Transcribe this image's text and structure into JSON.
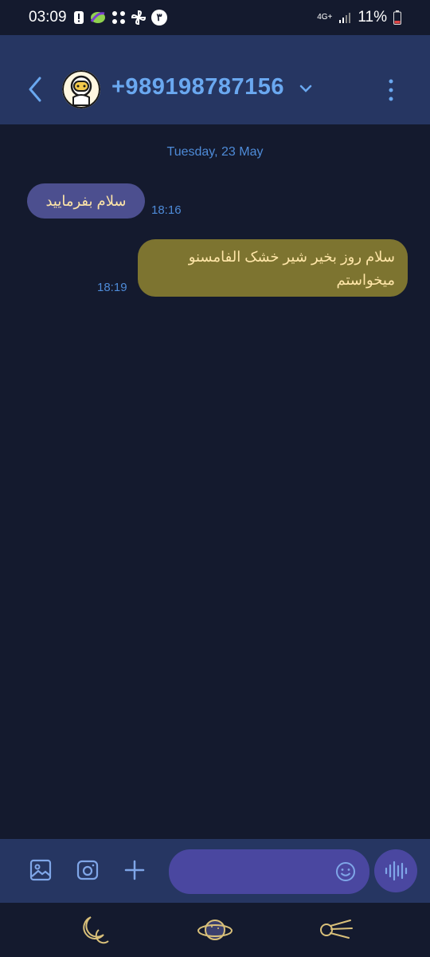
{
  "status": {
    "time": "03:09",
    "notif_badge": "۳",
    "network": "4G+",
    "battery": "11%"
  },
  "header": {
    "title": "+989198787156"
  },
  "chat": {
    "date": "Tuesday, 23 May",
    "messages": [
      {
        "direction": "incoming",
        "text": "سلام بفرمایید",
        "time": "18:16"
      },
      {
        "direction": "outgoing",
        "text": "سلام روز بخیر شیر خشک الفامسنو میخواستم",
        "time": "18:19"
      }
    ]
  },
  "composer": {
    "placeholder": ""
  },
  "colors": {
    "background": "#141a2e",
    "appbar": "#263662",
    "accent": "#6aa8f0",
    "incoming_bubble": "#4c4f8f",
    "outgoing_bubble": "#7d7430",
    "bubble_text": "#ffe6a8"
  },
  "icons": [
    "back-icon",
    "avatar",
    "chevron-down-icon",
    "more-vert-icon",
    "gallery-icon",
    "camera-icon",
    "plus-icon",
    "emoji-icon",
    "voice-icon",
    "moon-icon",
    "planet-icon",
    "comet-icon"
  ]
}
